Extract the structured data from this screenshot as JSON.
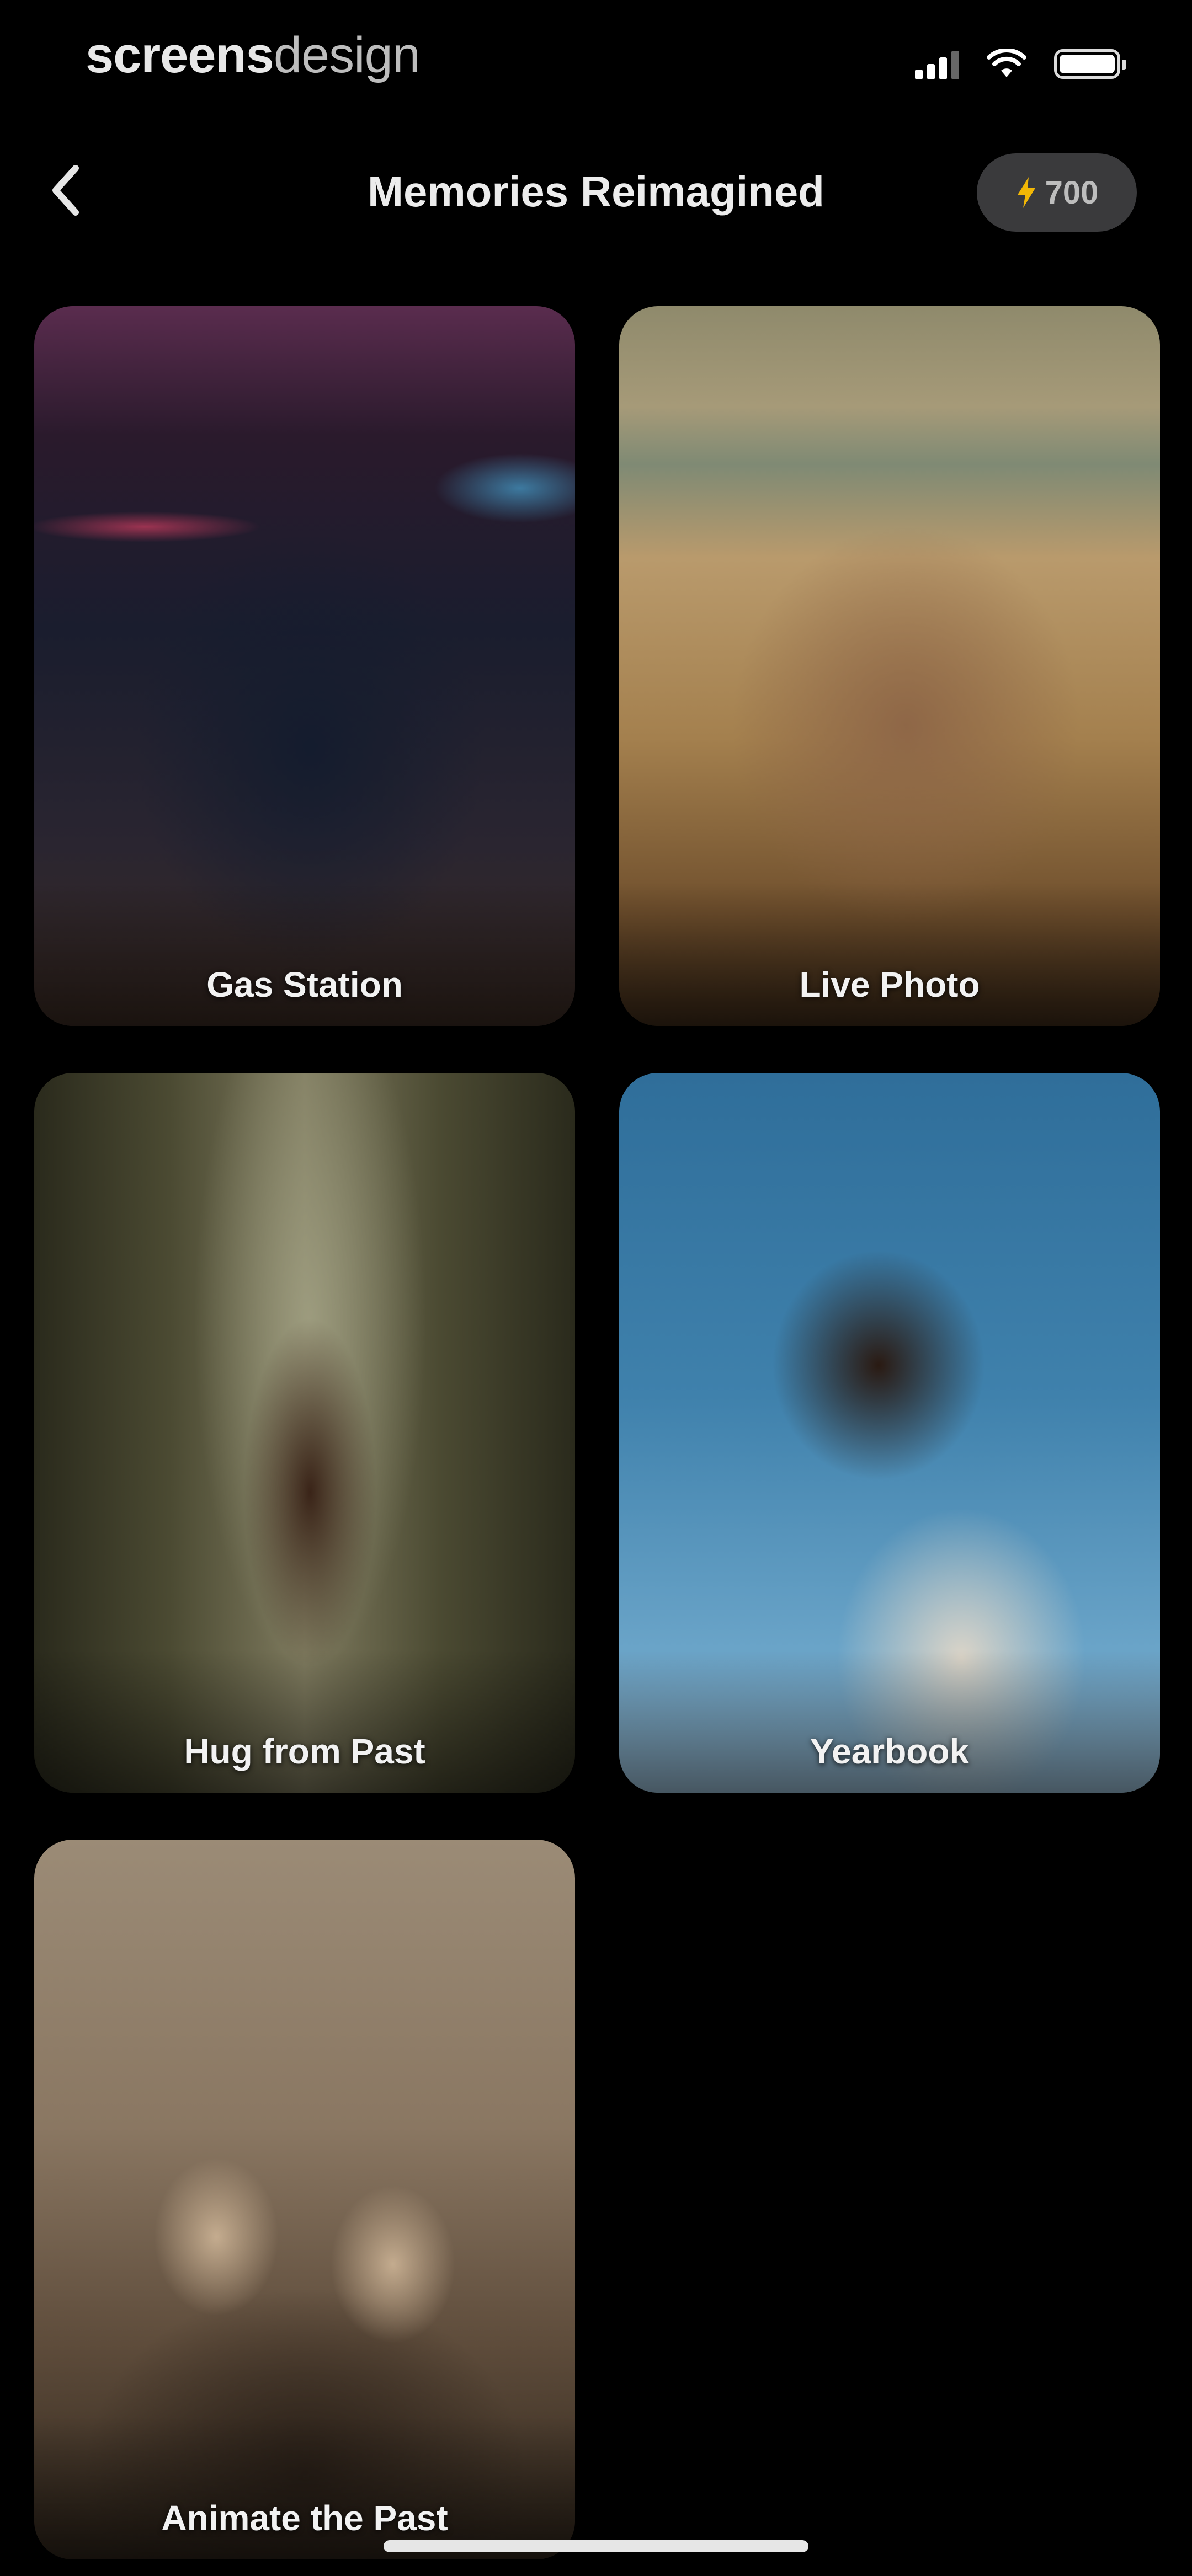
{
  "status_bar": {
    "brand_bold": "screens",
    "brand_light": "design",
    "icons": [
      "cellular-signal-icon",
      "wifi-icon",
      "battery-icon"
    ]
  },
  "header": {
    "back_icon": "chevron-left-icon",
    "title": "Memories Reimagined",
    "credits_icon": "lightning-bolt-icon",
    "credits": "700"
  },
  "cards": [
    {
      "label": "Gas Station"
    },
    {
      "label": "Live Photo"
    },
    {
      "label": "Hug from Past"
    },
    {
      "label": "Yearbook"
    },
    {
      "label": "Animate the Past"
    }
  ],
  "colors": {
    "background": "#000000",
    "badge_background": "#3a3a3c",
    "accent_bolt": "#f2b705",
    "text": "#ececec"
  }
}
